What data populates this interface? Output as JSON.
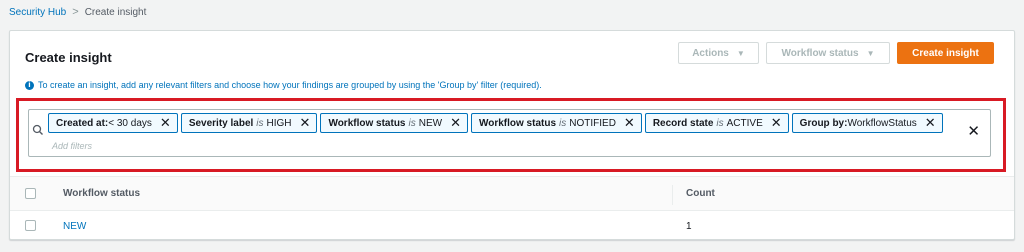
{
  "breadcrumb": {
    "root": "Security Hub",
    "separator": ">",
    "current": "Create insight"
  },
  "panel": {
    "title": "Create insight",
    "actions_label": "Actions",
    "workflow_status_label": "Workflow status",
    "create_label": "Create insight",
    "dropdown_caret": "▼"
  },
  "info": {
    "icon_glyph": "i",
    "text": "To create an insight, add any relevant filters and choose how your findings are grouped by using the 'Group by' filter (required)."
  },
  "filters": {
    "tokens": [
      {
        "key": "Created at",
        "op": "",
        "sep": ": ",
        "value": "< 30 days"
      },
      {
        "key": "Severity label",
        "op": "is",
        "sep": "",
        "value": "HIGH"
      },
      {
        "key": "Workflow status",
        "op": "is",
        "sep": "",
        "value": "NEW"
      },
      {
        "key": "Workflow status",
        "op": "is",
        "sep": "",
        "value": "NOTIFIED"
      },
      {
        "key": "Record state",
        "op": "is",
        "sep": "",
        "value": "ACTIVE"
      },
      {
        "key": "Group by",
        "op": "",
        "sep": ": ",
        "value": "WorkflowStatus"
      }
    ],
    "remove_glyph": "✕",
    "placeholder": "Add filters",
    "clear_glyph": "✕"
  },
  "table": {
    "columns": [
      "Workflow status",
      "Count"
    ],
    "rows": [
      {
        "workflow_status": "NEW",
        "count": "1"
      }
    ]
  },
  "colors": {
    "accent": "#0073bb",
    "primary_button": "#ec7211",
    "highlight_frame": "#d81a24"
  }
}
